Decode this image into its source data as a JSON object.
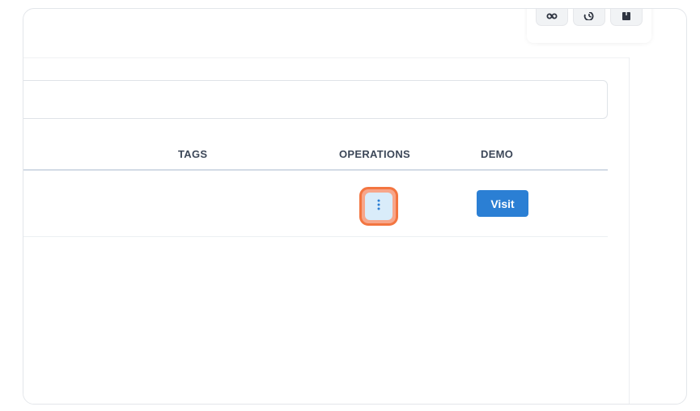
{
  "table": {
    "headers": {
      "tags": "TAGS",
      "operations": "OPERATIONS",
      "demo": "DEMO"
    },
    "rows": [
      {
        "tags": "",
        "demo_label": "Visit"
      }
    ]
  },
  "toolbar": {
    "icons": [
      "link-icon",
      "history-icon",
      "package-icon"
    ]
  },
  "colors": {
    "accent": "#2b7fd4",
    "highlight": "#f37540",
    "header_text": "#3c4758"
  }
}
